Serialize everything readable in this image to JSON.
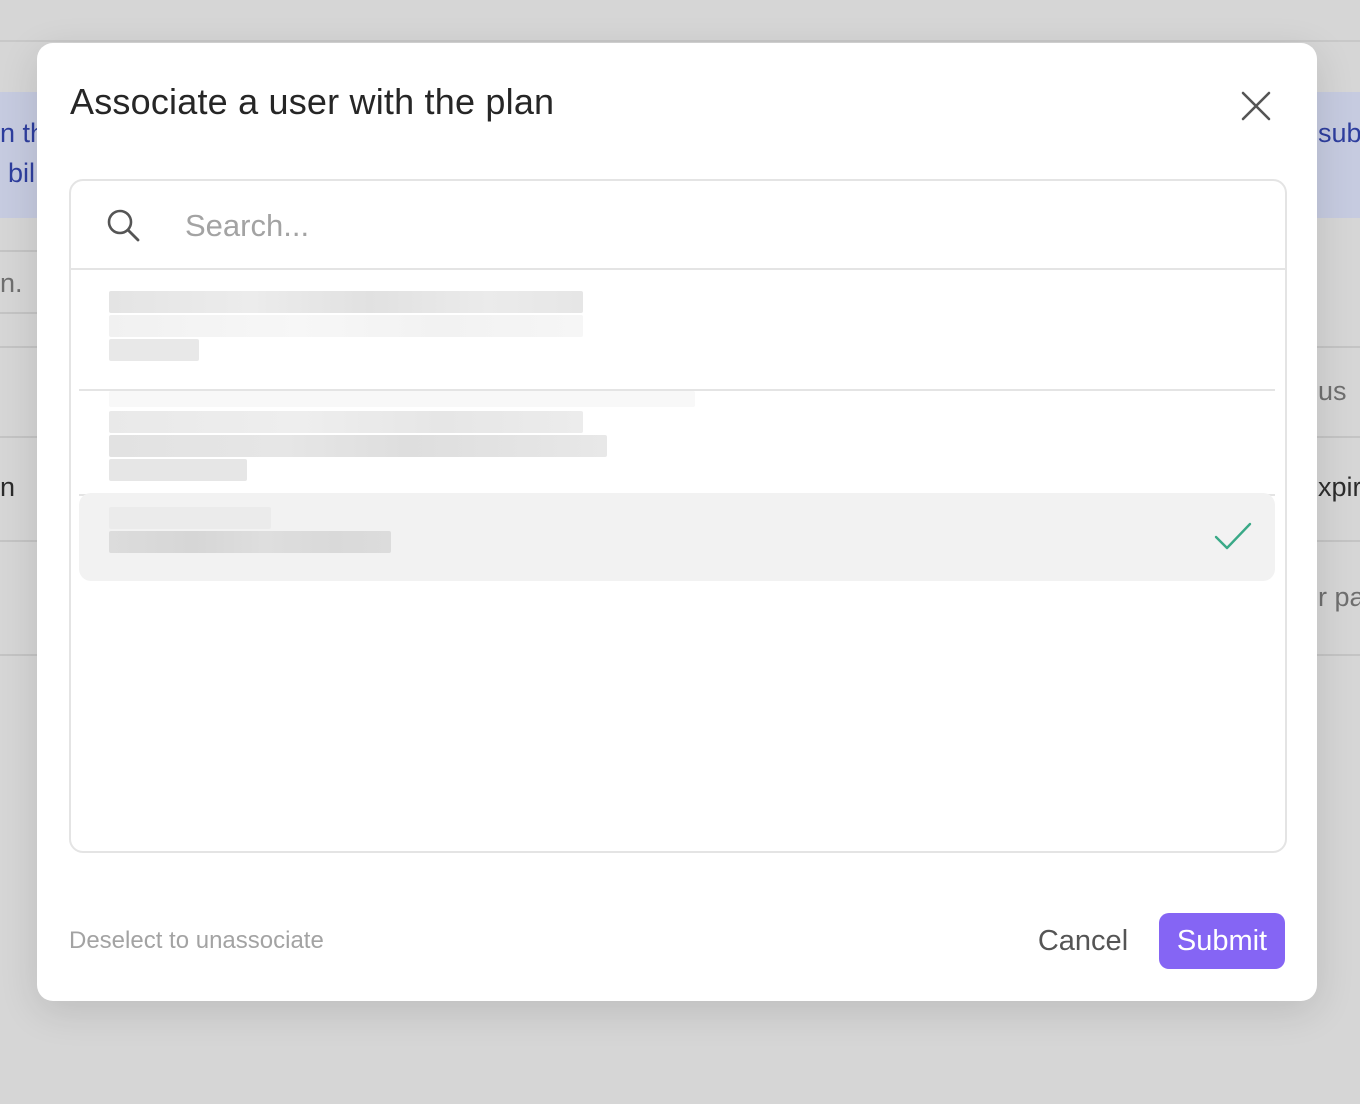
{
  "background": {
    "left_fragments": [
      "n th",
      "bil",
      "n.",
      "n"
    ],
    "right_fragments": [
      "sub",
      "us",
      "xpir",
      "r pa"
    ]
  },
  "modal": {
    "title": "Associate a user with the plan",
    "close_icon": "close-icon",
    "search": {
      "placeholder": "Search...",
      "value": "",
      "icon": "search-icon"
    },
    "options": [
      {
        "label": "",
        "redacted": true,
        "selected": false
      },
      {
        "label": "",
        "redacted": true,
        "selected": false
      },
      {
        "label": "",
        "redacted": true,
        "selected": true,
        "indicator_icon": "check-icon"
      }
    ],
    "hint": "Deselect to unassociate",
    "cancel_label": "Cancel",
    "submit_label": "Submit"
  },
  "colors": {
    "accent": "#8565f4",
    "check": "#3aa987",
    "link": "#2e3e9e",
    "overlay": "#d6d6d6",
    "selected_row": "#f2f2f2"
  }
}
